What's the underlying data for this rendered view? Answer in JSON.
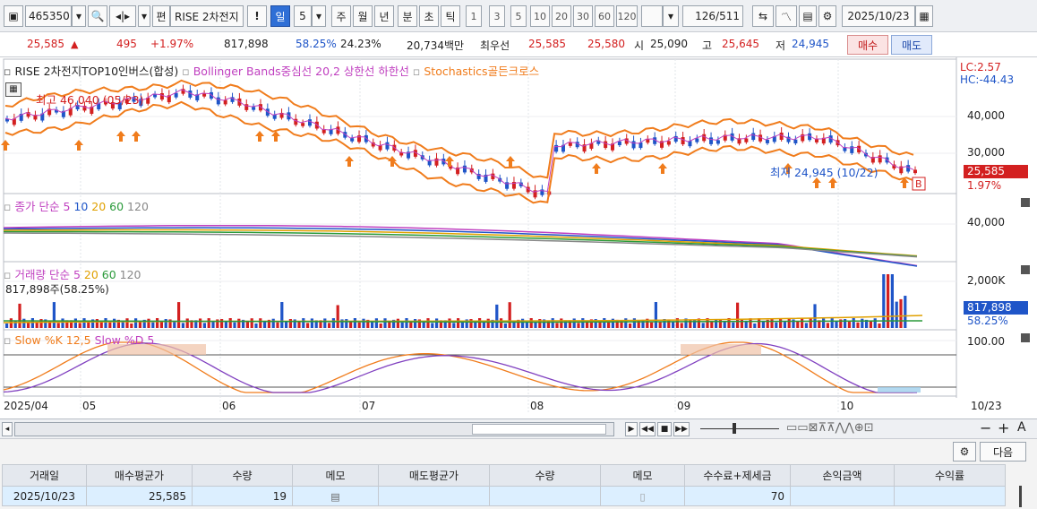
{
  "toolbar": {
    "stock_code": "465350",
    "stock_name": "RISE 2차전지",
    "edit_icon_label": "편",
    "excl_label": "!",
    "periods": [
      "일",
      "5",
      "주",
      "월",
      "년",
      "분",
      "초",
      "틱"
    ],
    "active_period": "일",
    "minute_options": [
      "1",
      "3",
      "5",
      "10",
      "20",
      "30",
      "60",
      "120"
    ],
    "count": "126",
    "total": "/511",
    "date": "2025/10/23"
  },
  "quote": {
    "price": "25,585",
    "change_arrow": "▲",
    "change": "495",
    "change_pct": "+1.97%",
    "volume": "817,898",
    "vol_ratio": "58.25%",
    "turnover": "24.23%",
    "amount": "20,734백만",
    "best_label": "최우선",
    "best_ask": "25,585",
    "best_bid": "25,580",
    "open_label": "시",
    "open": "25,090",
    "high_label": "고",
    "high": "25,645",
    "low_label": "저",
    "low": "24,945",
    "buy_label": "매수",
    "sell_label": "매도"
  },
  "legends": {
    "main_name": "RISE 2차전지TOP10인버스(합성)",
    "bollinger": "Bollinger Bands중심선 20,2  상한선  하한선",
    "stochastic": "Stochastics골든크로스",
    "lc": "LC:2.57",
    "hc": "HC:-44.43",
    "high_note": "최고 46,040 (05/23)",
    "low_note": "최저 24,945 (10/22)",
    "signal_label": "B",
    "ma_name": "종가 단순",
    "ma_periods": [
      "5",
      "10",
      "20",
      "60",
      "120"
    ],
    "vol_name": "거래량 단순",
    "vol_periods": [
      "5",
      "20",
      "60",
      "120"
    ],
    "vol_info": "817,898주(58.25%)",
    "slow_k": "Slow %K 12,5",
    "slow_d": "Slow %D 5"
  },
  "axes": {
    "price_ticks": [
      "40,000",
      "30,000"
    ],
    "current_price": "25,585",
    "current_pct": "1.97%",
    "ma_tick": "40,000",
    "vol_tick": "2,000K",
    "vol_current": "817,898",
    "vol_pct": "58.25%",
    "stoch_tick": "100.00",
    "date_labels": [
      "2025/04",
      "05",
      "06",
      "07",
      "08",
      "09",
      "10",
      "10/23"
    ]
  },
  "colors": {
    "up": "#d32020",
    "down": "#1f55c8",
    "bollinger": "#f07c1c",
    "center": "#c040c0",
    "ma5": "#c040c0",
    "ma10": "#1f55c8",
    "ma20": "#e0a000",
    "ma60": "#2a9a3a",
    "ma120": "#888888"
  },
  "grid": {
    "next_label": "다음",
    "headers": [
      "거래일",
      "매수평균가",
      "수량",
      "메모",
      "매도평균가",
      "수량",
      "메모",
      "수수료+제세금",
      "손익금액",
      "수익률"
    ],
    "rows": [
      [
        "2025/10/23",
        "25,585",
        "19",
        "",
        "",
        "",
        "",
        "70",
        "",
        ""
      ]
    ]
  }
}
